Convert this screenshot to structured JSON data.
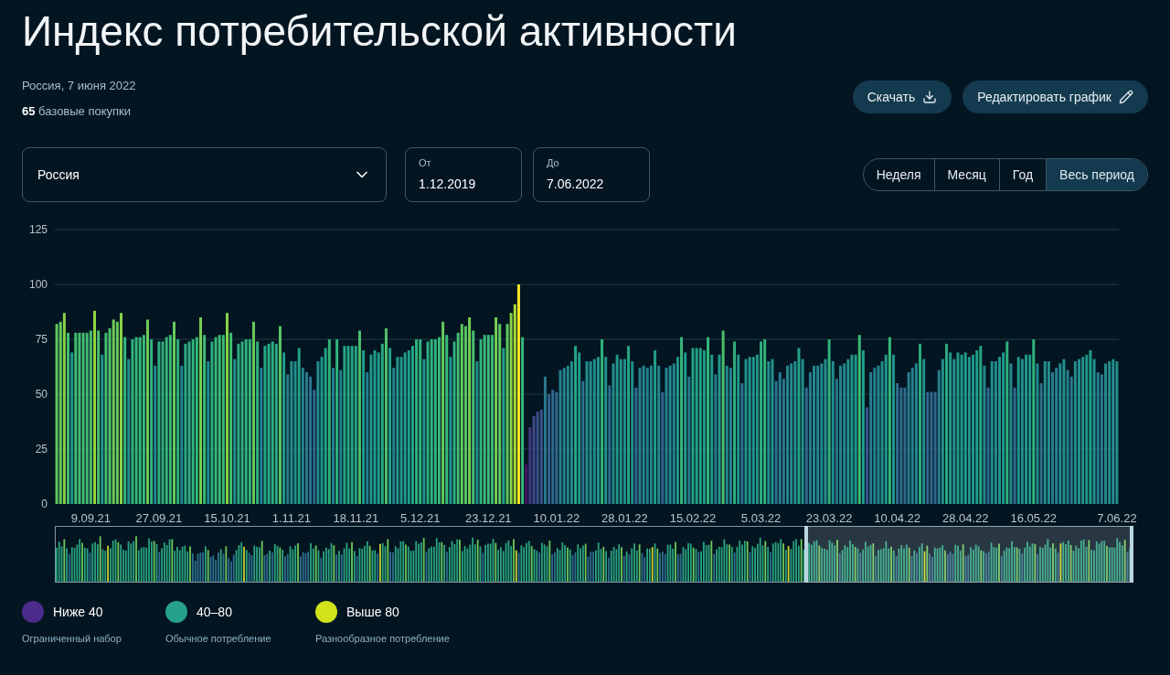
{
  "title": "Индекс потребительской активности",
  "meta": {
    "date_line": "Россия, 7 июня 2022",
    "count": "65",
    "count_label": "базовые покупки"
  },
  "actions": [
    {
      "kind": "download",
      "label": "Скачать"
    },
    {
      "kind": "edit",
      "label": "Редактировать график"
    }
  ],
  "region_select": {
    "value": "Россия"
  },
  "date_from": {
    "label": "От",
    "value": "1.12.2019"
  },
  "date_to": {
    "label": "До",
    "value": "7.06.2022"
  },
  "period_tabs": [
    {
      "label": "Неделя",
      "selected": false
    },
    {
      "label": "Месяц",
      "selected": false
    },
    {
      "label": "Год",
      "selected": false
    },
    {
      "label": "Весь период",
      "selected": true
    }
  ],
  "chart_data": {
    "type": "bar",
    "grid": true,
    "ylim": [
      0,
      125
    ],
    "yticks": [
      0,
      25,
      50,
      75,
      100,
      125
    ],
    "categories": [
      null,
      null,
      null,
      null,
      null,
      null,
      null,
      null,
      null,
      "9.09.21",
      null,
      null,
      null,
      null,
      null,
      null,
      null,
      null,
      null,
      null,
      null,
      null,
      null,
      null,
      null,
      null,
      null,
      "27.09.21",
      null,
      null,
      null,
      null,
      null,
      null,
      null,
      null,
      null,
      null,
      null,
      null,
      null,
      null,
      null,
      null,
      null,
      "15.10.21",
      null,
      null,
      null,
      null,
      null,
      null,
      null,
      null,
      null,
      null,
      null,
      null,
      null,
      null,
      null,
      null,
      "1.11.21",
      null,
      null,
      null,
      null,
      null,
      null,
      null,
      null,
      null,
      null,
      null,
      null,
      null,
      null,
      null,
      null,
      "18.11.21",
      null,
      null,
      null,
      null,
      null,
      null,
      null,
      null,
      null,
      null,
      null,
      null,
      null,
      null,
      null,
      null,
      "5.12.21",
      null,
      null,
      null,
      null,
      null,
      null,
      null,
      null,
      null,
      null,
      null,
      null,
      null,
      null,
      null,
      null,
      null,
      "23.12.21",
      null,
      null,
      null,
      null,
      null,
      null,
      null,
      null,
      null,
      null,
      null,
      null,
      null,
      null,
      null,
      null,
      null,
      "10.01.22",
      null,
      null,
      null,
      null,
      null,
      null,
      null,
      null,
      null,
      null,
      null,
      null,
      null,
      null,
      null,
      null,
      null,
      "28.01.22",
      null,
      null,
      null,
      null,
      null,
      null,
      null,
      null,
      null,
      null,
      null,
      null,
      null,
      null,
      null,
      null,
      null,
      "15.02.22",
      null,
      null,
      null,
      null,
      null,
      null,
      null,
      null,
      null,
      null,
      null,
      null,
      null,
      null,
      null,
      null,
      null,
      "5.03.22",
      null,
      null,
      null,
      null,
      null,
      null,
      null,
      null,
      null,
      null,
      null,
      null,
      null,
      null,
      null,
      null,
      null,
      "23.03.22",
      null,
      null,
      null,
      null,
      null,
      null,
      null,
      null,
      null,
      null,
      null,
      null,
      null,
      null,
      null,
      null,
      null,
      "10.04.22",
      null,
      null,
      null,
      null,
      null,
      null,
      null,
      null,
      null,
      null,
      null,
      null,
      null,
      null,
      null,
      null,
      null,
      "28.04.22",
      null,
      null,
      null,
      null,
      null,
      null,
      null,
      null,
      null,
      null,
      null,
      null,
      null,
      null,
      null,
      null,
      null,
      "16.05.22",
      null,
      null,
      null,
      null,
      null,
      null,
      null,
      null,
      null,
      null,
      null,
      null,
      null,
      null,
      null,
      null,
      null,
      null,
      null,
      null,
      null,
      "7.06.22"
    ],
    "values": [
      82,
      83,
      87,
      78,
      69,
      78,
      78,
      78,
      78,
      79,
      88,
      79,
      68,
      78,
      80,
      84,
      83,
      87,
      76,
      66,
      75,
      76,
      76,
      77,
      84,
      75,
      63,
      74,
      74,
      76,
      77,
      83,
      75,
      63,
      73,
      74,
      75,
      76,
      85,
      77,
      65,
      74,
      76,
      77,
      77,
      87,
      78,
      66,
      73,
      74,
      75,
      75,
      83,
      74,
      62,
      72,
      73,
      74,
      73,
      81,
      69,
      59,
      65,
      65,
      71,
      62,
      60,
      58,
      52,
      65,
      67,
      71,
      75,
      62,
      75,
      61,
      72,
      72,
      72,
      72,
      79,
      70,
      60,
      68,
      70,
      69,
      73,
      80,
      71,
      62,
      67,
      67,
      69,
      70,
      72,
      75,
      75,
      66,
      74,
      75,
      75,
      76,
      83,
      77,
      67,
      74,
      78,
      82,
      81,
      85,
      79,
      65,
      75,
      77,
      77,
      77,
      85,
      82,
      71,
      82,
      87,
      91,
      100,
      76,
      18,
      35,
      40,
      42,
      43,
      58,
      50,
      52,
      51,
      61,
      62,
      63,
      65,
      72,
      69,
      56,
      65,
      65,
      66,
      67,
      75,
      67,
      54,
      64,
      68,
      66,
      66,
      72,
      65,
      53,
      62,
      63,
      62,
      63,
      70,
      63,
      51,
      62,
      63,
      64,
      67,
      76,
      69,
      58,
      71,
      71,
      71,
      70,
      76,
      68,
      59,
      68,
      79,
      63,
      62,
      74,
      68,
      55,
      66,
      67,
      67,
      68,
      74,
      75,
      65,
      66,
      56,
      60,
      57,
      63,
      64,
      65,
      71,
      66,
      53,
      60,
      63,
      63,
      64,
      66,
      75,
      65,
      57,
      63,
      64,
      66,
      68,
      68,
      77,
      70,
      44,
      60,
      62,
      63,
      65,
      68,
      76,
      68,
      55,
      53,
      53,
      60,
      62,
      64,
      73,
      66,
      51,
      51,
      51,
      61,
      66,
      73,
      69,
      66,
      69,
      68,
      69,
      67,
      68,
      70,
      72,
      63,
      53,
      65,
      65,
      67,
      69,
      74,
      64,
      53,
      67,
      66,
      68,
      68,
      75,
      64,
      55,
      65,
      65,
      60,
      62,
      64,
      66,
      61,
      58,
      65,
      66,
      67,
      68,
      70,
      66,
      60,
      59,
      64,
      65,
      66,
      65
    ]
  },
  "legend": [
    {
      "color": "#4b2c8a",
      "label": "Ниже 40",
      "description": "Ограниченный набор"
    },
    {
      "color": "#24a08c",
      "label": "40–80",
      "description": "Обычное потребление"
    },
    {
      "color": "#d2e21b",
      "label": "Выше 80",
      "description": "Разнообразное потребление"
    }
  ]
}
